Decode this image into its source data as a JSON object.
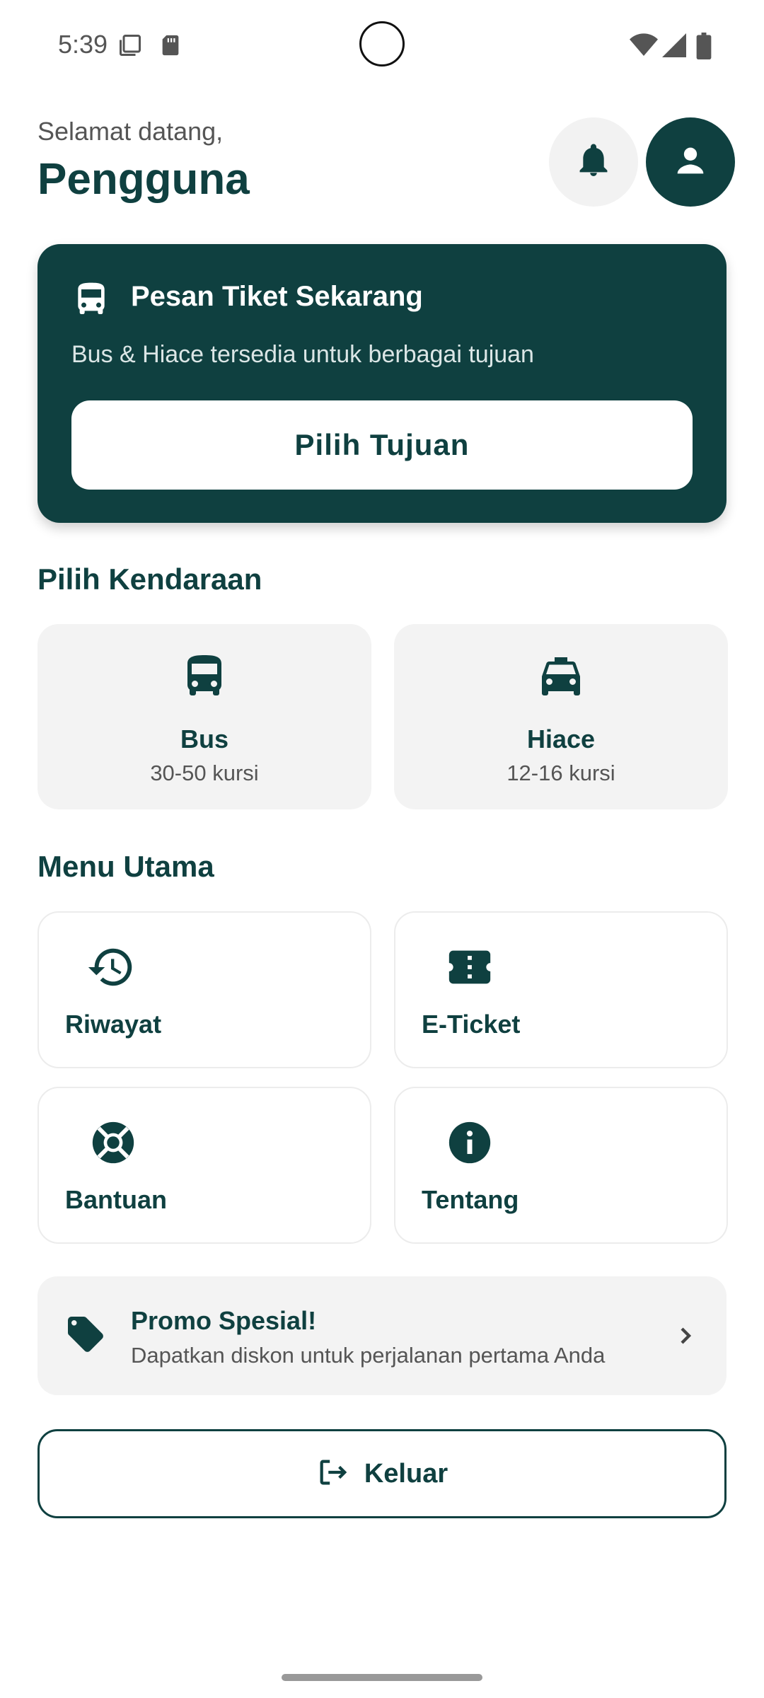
{
  "status_bar": {
    "time": "5:39",
    "icons": [
      "screenshot-icon",
      "sd-card-icon",
      "wifi-icon",
      "cellular-signal-icon",
      "battery-icon"
    ]
  },
  "header": {
    "greeting": "Selamat datang,",
    "username": "Pengguna",
    "icons": [
      "bell-icon",
      "person-icon"
    ]
  },
  "booking": {
    "icon": "bus-icon",
    "title": "Pesan Tiket Sekarang",
    "subtitle": "Bus & Hiace tersedia untuk berbagai tujuan",
    "button_label": "Pilih Tujuan"
  },
  "vehicles": {
    "title": "Pilih Kendaraan",
    "items": [
      {
        "icon": "bus-icon",
        "name": "Bus",
        "seats": "30-50 kursi"
      },
      {
        "icon": "taxi-icon",
        "name": "Hiace",
        "seats": "12-16 kursi"
      }
    ]
  },
  "menu": {
    "title": "Menu Utama",
    "items": [
      {
        "icon": "history-icon",
        "label": "Riwayat"
      },
      {
        "icon": "ticket-icon",
        "label": "E-Ticket"
      },
      {
        "icon": "lifebuoy-icon",
        "label": "Bantuan"
      },
      {
        "icon": "info-icon",
        "label": "Tentang"
      }
    ]
  },
  "promo": {
    "icon": "tag-icon",
    "title": "Promo Spesial!",
    "subtitle": "Dapatkan diskon untuk perjalanan pertama Anda"
  },
  "logout": {
    "icon": "logout-icon",
    "label": "Keluar"
  },
  "colors": {
    "primary": "#0f4040",
    "card_bg": "#f3f3f3",
    "white": "#ffffff",
    "muted_text": "#555555"
  }
}
